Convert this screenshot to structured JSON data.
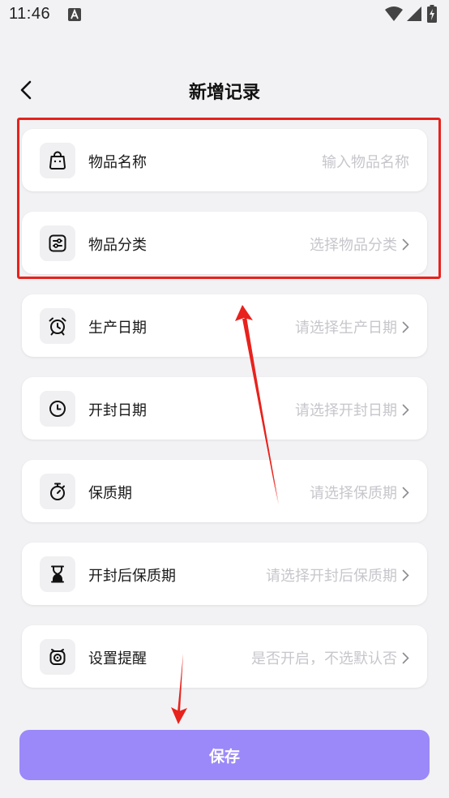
{
  "status_bar": {
    "time": "11:46",
    "icons": [
      "a-notification-icon",
      "wifi-icon",
      "signal-icon",
      "battery-charging-icon"
    ]
  },
  "header": {
    "back_icon": "chevron-left-icon",
    "title": "新增记录"
  },
  "fields": [
    {
      "label": "物品名称",
      "placeholder": "输入物品名称",
      "icon": "bag-icon",
      "chevron": false
    },
    {
      "label": "物品分类",
      "placeholder": "选择物品分类",
      "icon": "sliders-icon",
      "chevron": true
    },
    {
      "label": "生产日期",
      "placeholder": "请选择生产日期",
      "icon": "alarm-clock-icon",
      "chevron": true
    },
    {
      "label": "开封日期",
      "placeholder": "请选择开封日期",
      "icon": "clock-icon",
      "chevron": true
    },
    {
      "label": "保质期",
      "placeholder": "请选择保质期",
      "icon": "stopwatch-icon",
      "chevron": true
    },
    {
      "label": "开封后保质期",
      "placeholder": "请选择开封后保质期",
      "icon": "hourglass-icon",
      "chevron": true
    },
    {
      "label": "设置提醒",
      "placeholder": "是否开启，不选默认否",
      "icon": "alarm-icon",
      "chevron": true
    }
  ],
  "save_button": {
    "label": "保存"
  },
  "colors": {
    "background": "#f2f2f4",
    "card": "#ffffff",
    "placeholder": "#c6c6cc",
    "save_button": "#9b88f9",
    "annotation": "#e8221c"
  }
}
